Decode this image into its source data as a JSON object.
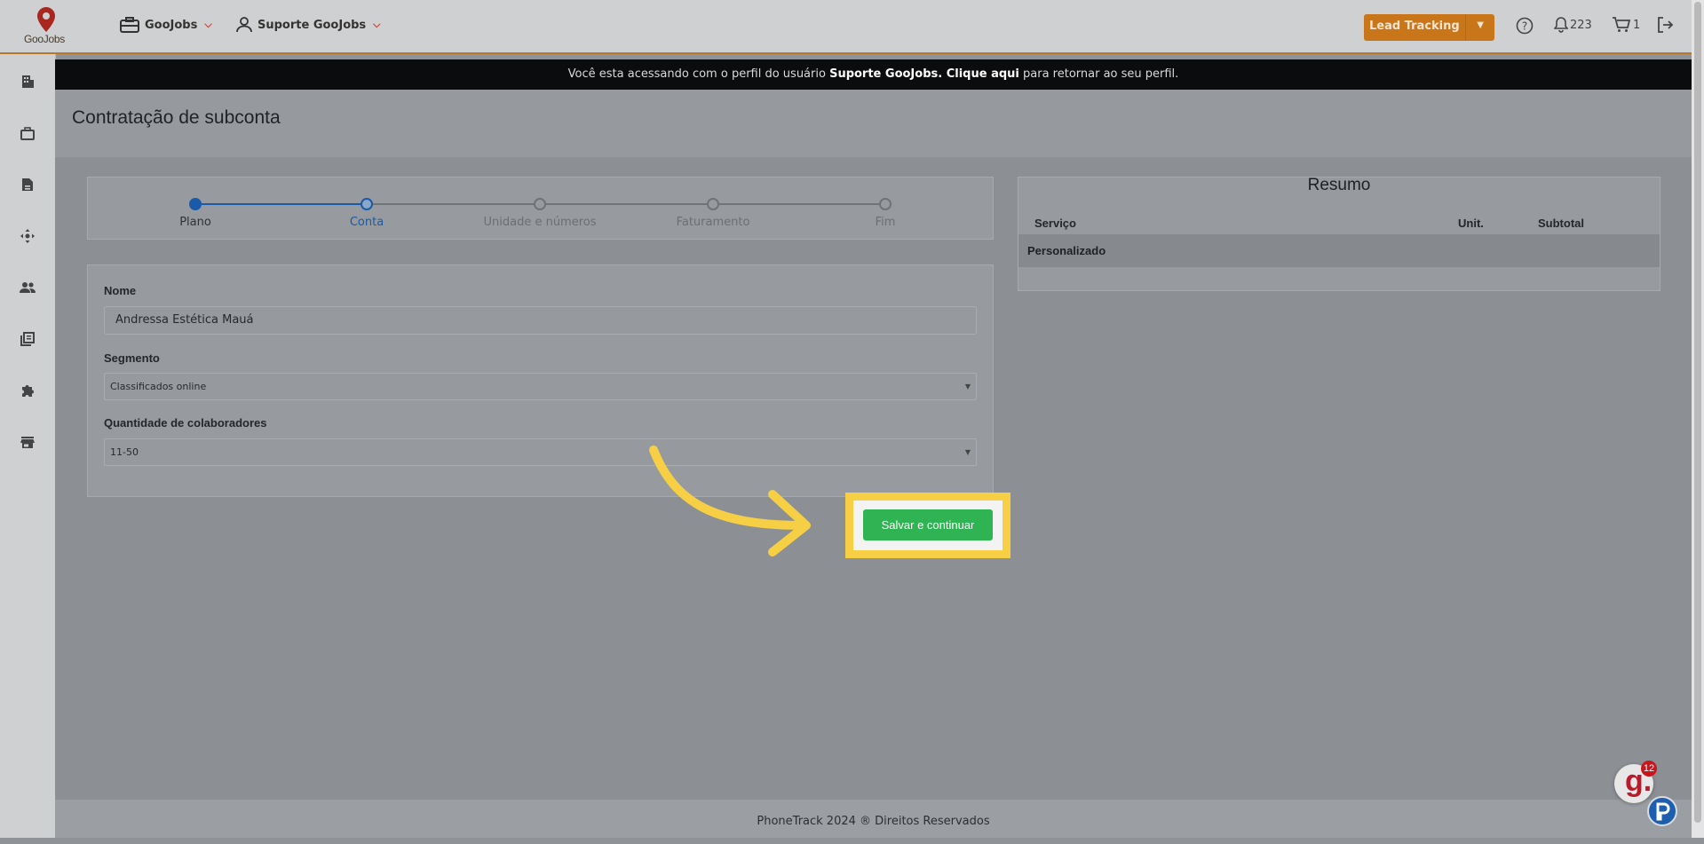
{
  "header": {
    "logo_text": "GooJobs",
    "company_menu": "GooJobs",
    "user_menu": "Suporte GooJobs",
    "lead_button": "Lead Tracking",
    "notifications_count": "223",
    "cart_count": "1"
  },
  "banner": {
    "prefix": "Você esta acessando com o perfil do usuário ",
    "user": "Suporte GooJobs",
    "dot": ". ",
    "link": "Clique aqui",
    "suffix": " para retornar ao seu perfil."
  },
  "page": {
    "title": "Contratação de subconta"
  },
  "stepper": {
    "steps": [
      {
        "label": "Plano",
        "state": "done"
      },
      {
        "label": "Conta",
        "state": "current"
      },
      {
        "label": "Unidade e números",
        "state": "pending"
      },
      {
        "label": "Faturamento",
        "state": "pending"
      },
      {
        "label": "Fim",
        "state": "pending"
      }
    ]
  },
  "form": {
    "name_label": "Nome",
    "name_value": "Andressa Estética Mauá",
    "segment_label": "Segmento",
    "segment_value": "Classificados online",
    "staff_label": "Quantidade de colaboradores",
    "staff_value": "11-50"
  },
  "summary": {
    "title": "Resumo",
    "columns": [
      "Serviço",
      "Unit.",
      "Subtotal"
    ],
    "rows": [
      {
        "service": "Personalizado"
      }
    ]
  },
  "actions": {
    "save_label": "Salvar e continuar"
  },
  "footer": {
    "text": "PhoneTrack 2024 ® Direitos Reservados"
  },
  "chat": {
    "badge": "12"
  },
  "colors": {
    "accent": "#c9761b",
    "primary": "#1a5aa8",
    "success": "#2fb353",
    "highlight": "#f6cf45"
  }
}
